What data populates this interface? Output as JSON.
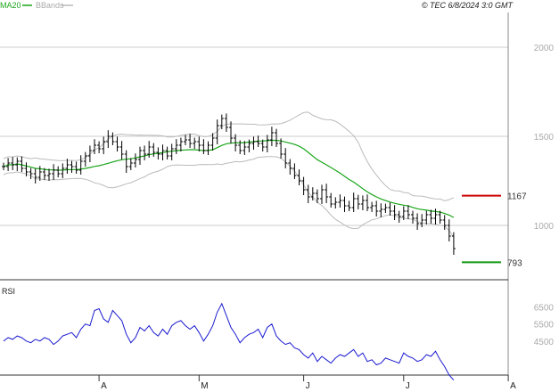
{
  "header": {
    "legend_ma": "MA20",
    "legend_bb": "BBands",
    "copyright": "© TEC 6/8/2024 3:0 GMT"
  },
  "colors": {
    "ma": "#1aa51a",
    "bands": "#bbbbbb",
    "price": "#000000",
    "rsi": "#1a1ad0",
    "resistance": "#cc0000",
    "support": "#119911",
    "grid": "#cccccc"
  },
  "chart_data": [
    {
      "type": "line",
      "panel": "price",
      "title": "",
      "y_ticks": [
        "2000",
        "1500",
        "1000"
      ],
      "ylim": [
        695,
        2195
      ],
      "grid": true,
      "x_labels": [
        "A",
        "M",
        "J",
        "J",
        "A"
      ],
      "x_label_index": [
        21,
        43,
        66,
        88,
        111
      ],
      "series": [
        {
          "name": "",
          "style": "ohlc-bars",
          "close": [
            1330,
            1350,
            1340,
            1360,
            1320,
            1300,
            1290,
            1270,
            1300,
            1280,
            1290,
            1310,
            1290,
            1320,
            1340,
            1330,
            1310,
            1360,
            1390,
            1420,
            1450,
            1430,
            1470,
            1500,
            1470,
            1440,
            1400,
            1330,
            1350,
            1370,
            1420,
            1400,
            1440,
            1410,
            1400,
            1420,
            1390,
            1430,
            1450,
            1470,
            1480,
            1460,
            1470,
            1450,
            1420,
            1450,
            1490,
            1560,
            1600,
            1550,
            1490,
            1450,
            1420,
            1440,
            1460,
            1470,
            1460,
            1440,
            1480,
            1520,
            1460,
            1400,
            1350,
            1320,
            1280,
            1250,
            1200,
            1160,
            1180,
            1150,
            1200,
            1160,
            1120,
            1130,
            1140,
            1110,
            1100,
            1150,
            1120,
            1140,
            1100,
            1110,
            1080,
            1090,
            1100,
            1080,
            1060,
            1050,
            1080,
            1060,
            1040,
            1010,
            1030,
            1060,
            1040,
            1060,
            1030,
            1000,
            940,
            870
          ]
        },
        {
          "name": "MA20",
          "style": "line"
        },
        {
          "name": "BBands",
          "style": "band"
        }
      ],
      "levels": [
        {
          "label": "1167",
          "value": 1167,
          "color": "#cc0000"
        },
        {
          "label": "793",
          "value": 793,
          "color": "#119911"
        }
      ]
    },
    {
      "type": "line",
      "panel": "rsi",
      "title": "RSI",
      "y_ticks": [
        "6500",
        "5500",
        "4500"
      ],
      "ylim": [
        25,
        80
      ],
      "series": [
        {
          "name": "RSI",
          "values": [
            45,
            47,
            46,
            48,
            47,
            45,
            44,
            46,
            45,
            47,
            46,
            43,
            45,
            48,
            49,
            50,
            47,
            52,
            55,
            54,
            63,
            64,
            58,
            56,
            63,
            60,
            57,
            49,
            44,
            47,
            53,
            51,
            54,
            50,
            48,
            52,
            49,
            54,
            56,
            57,
            54,
            52,
            54,
            50,
            45,
            49,
            54,
            62,
            67,
            60,
            53,
            49,
            44,
            47,
            49,
            50,
            52,
            47,
            53,
            55,
            48,
            45,
            43,
            44,
            41,
            40,
            37,
            35,
            38,
            33,
            36,
            34,
            32,
            35,
            37,
            36,
            38,
            40,
            36,
            38,
            33,
            34,
            31,
            32,
            35,
            34,
            33,
            32,
            38,
            36,
            35,
            33,
            34,
            37,
            36,
            39,
            34,
            30,
            25,
            22
          ]
        }
      ]
    }
  ]
}
